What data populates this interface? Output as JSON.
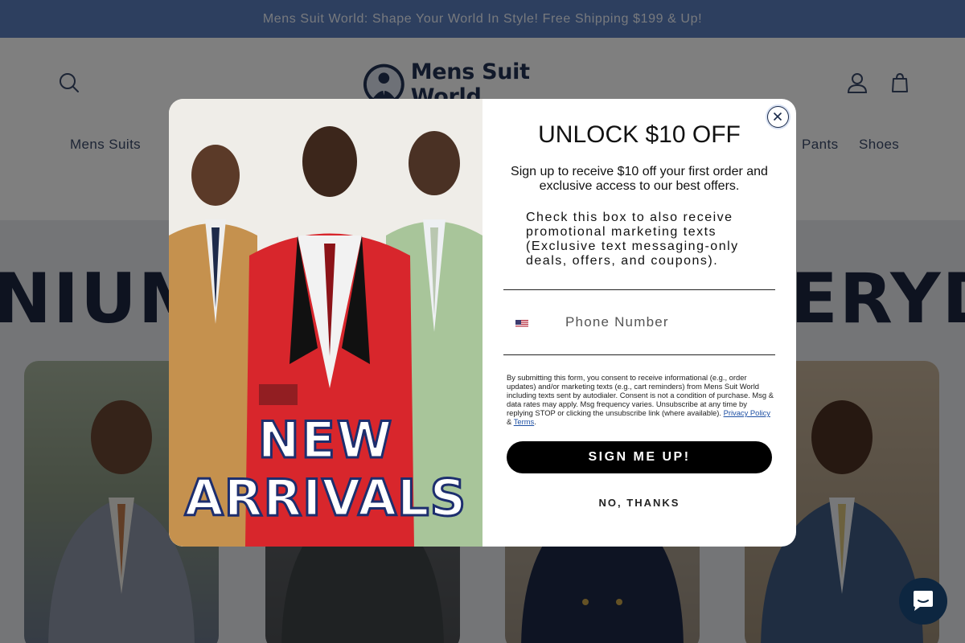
{
  "announcement": "Mens Suit World: Shape Your World In Style! Free Shipping $199 & Up!",
  "header": {
    "logo_text": "Mens Suit World",
    "icons": {
      "search": "search-icon",
      "login": "account-icon",
      "cart": "cart-icon"
    }
  },
  "nav": {
    "items": [
      "Mens Suits",
      "Pants",
      "Shoes"
    ]
  },
  "modal": {
    "title": "UNLOCK $10 OFF",
    "subtitle": "Sign up to receive $10 off your first order and exclusive access to our best offers.",
    "checkbox_label": "Check this box to also receive promotional marketing texts (Exclusive text messaging-only deals, offers, and coupons).",
    "phone_placeholder": "Phone Number",
    "promo_image_text_line1": "NEW",
    "promo_image_text_line2": "ARRIVALS",
    "legal_text": "By submitting this form, you consent to receive informational (e.g., order updates) and/or marketing texts (e.g., cart reminders) from Mens Suit World including texts sent by autodialer. Consent is not a condition of purchase. Msg & data rates may apply. Msg frequency varies. Unsubscribe at any time by replying STOP or clicking the unsubscribe link (where available).",
    "privacy_link": "Privacy Policy",
    "amp": "&",
    "terms_link": "Terms",
    "period": ".",
    "signup_label": "SIGN ME UP!",
    "decline_label": "NO, THANKS"
  },
  "hero": {
    "headline_visible": "NIUM SUITS FOR EVERYDAY CONFIDE"
  },
  "colors": {
    "announcement_bg": "#5b7fbf",
    "brand_navy": "#223355",
    "cta_black": "#000000",
    "chat_bg": "#0d2640",
    "promo_red": "#d8262c"
  }
}
